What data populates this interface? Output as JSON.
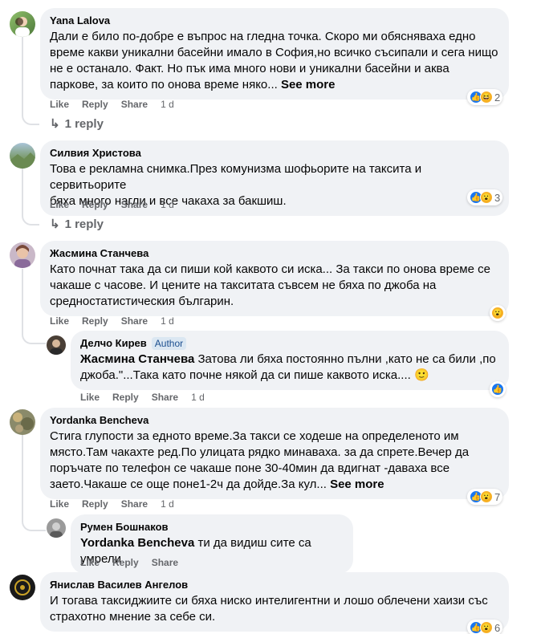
{
  "actions": {
    "like": "Like",
    "reply": "Reply",
    "share": "Share"
  },
  "comments": [
    {
      "author": "Yana Lalova",
      "lines": [
        "Дали е било по-добре е въпрос на гледна точка. Скоро ми обясняваха едно",
        "време какви уникални басейни имало в София,но всичко съсипали и сега нищо",
        "не е останало. Факт. Но пък има много нови и уникални басейни и аква"
      ],
      "last_line": "паркове, за които по онова време няко...",
      "see_more": "See more",
      "time": "1 d",
      "reaction_count": "2",
      "replies": "1 reply"
    },
    {
      "author": "Силвия Христова",
      "lines": [
        "Това е рекламна снимка.През комунизма шофьорите на таксита и сервитьорите",
        "бяха много нагли и все чакаха за бакшиш."
      ],
      "time": "1 d",
      "reaction_count": "3",
      "replies": "1 reply"
    },
    {
      "author": "Жасмина Станчева",
      "lines": [
        "Като почнат така да си пиши кой каквото си иска... За такси по онова време се",
        "чакаше с часове. И цените на такситата съвсем не бяха по джоба на",
        "средностатистическия българин."
      ],
      "time": "1 d"
    },
    {
      "author": "Делчо Кирев",
      "badge": "Author",
      "mention": "Жасмина Станчева",
      "first_line": "Затова ли бяха постоянно пълни ,като не са били ,по",
      "second_line": "джоба.\"...Така като почне някой да си пише каквото иска....",
      "emoji": "🙂",
      "time": "1 d"
    },
    {
      "author": "Yordanka Bencheva",
      "lines": [
        "Стига глупости за едното време.За такси се ходеше на определеното им",
        "място.Там чакахте ред.По улицата рядко минаваха. за да спрете.Вечер да",
        "поръчате по телефон се чакаше поне 30-40мин да вдигнат -даваха все"
      ],
      "last_line": "заето.Чакаше се още поне1-2ч да дойде.За кул...",
      "see_more": "See more",
      "time": "1 d",
      "reaction_count": "7"
    },
    {
      "author": "Румен Бошнаков",
      "mention": "Yordanka Bencheva",
      "text": "ти да видиш сите са умрели"
    },
    {
      "author": "Янислав Василев Ангелов",
      "lines": [
        "И тогава таксиджиите си бяха ниско интелигентни и лошо облечени хаизи със",
        "страхотно мнение за себе си."
      ],
      "reaction_count": "6"
    }
  ]
}
